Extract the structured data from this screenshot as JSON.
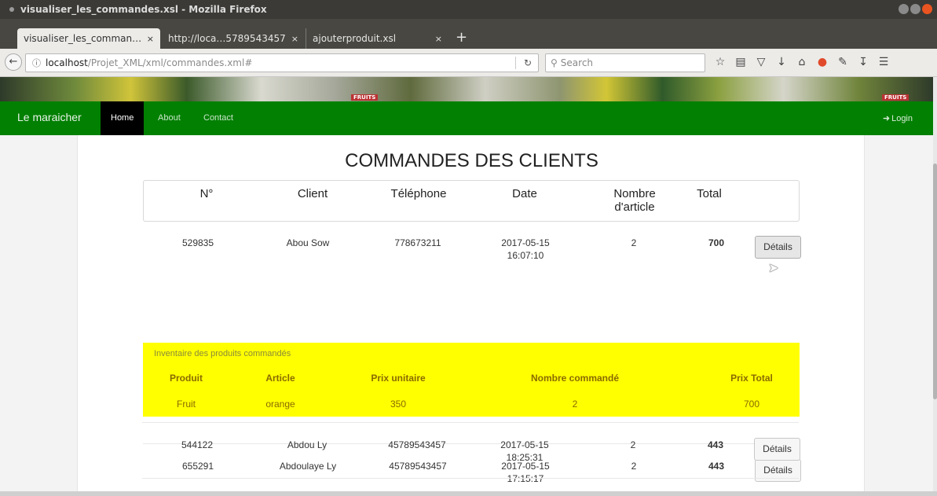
{
  "window": {
    "title": "visualiser_les_commandes.xsl - Mozilla Firefox"
  },
  "tabs": [
    {
      "label": "visualiser_les_comman…",
      "active": true
    },
    {
      "label": "http://loca…5789543457",
      "active": false
    },
    {
      "label": "ajouterproduit.xsl",
      "active": false
    }
  ],
  "tab_close_glyph": "×",
  "new_tab_glyph": "+",
  "url": {
    "host": "localhost",
    "path": "/Projet_XML/xml/commandes.xml#"
  },
  "search": {
    "placeholder": "Search"
  },
  "site": {
    "brand": "Le maraicher",
    "nav": {
      "home": "Home",
      "about": "About",
      "contact": "Contact"
    },
    "login": "Login",
    "banner_tag": "FRUITS"
  },
  "page": {
    "title": "COMMANDES DES CLIENTS",
    "columns": {
      "num": "N°",
      "client": "Client",
      "phone": "Téléphone",
      "date": "Date",
      "count_l1": "Nombre",
      "count_l2": "d'article",
      "total": "Total"
    },
    "details_label": "Détails",
    "orders": [
      {
        "num": "529835",
        "client": "Abou  Sow",
        "phone": "778673211",
        "date": "2017-05-15",
        "time": "16:07:10",
        "count": "2",
        "total": "700"
      },
      {
        "num": "655291",
        "client": "Abdoulaye  Ly",
        "phone": "45789543457",
        "date": "2017-05-15",
        "time": "17:15:17",
        "count": "2",
        "total": "443"
      },
      {
        "num": "544122",
        "client": "Abdou  Ly",
        "phone": "45789543457",
        "date": "2017-05-15",
        "time": "18:25:31",
        "count": "2",
        "total": "443"
      }
    ],
    "inventory": {
      "title": "Inventaire des produits commandés",
      "headers": {
        "product": "Produit",
        "article": "Article",
        "unit_price": "Prix unitaire",
        "ordered": "Nombre commandé",
        "total_price": "Prix Total"
      },
      "row": {
        "product": "Fruit",
        "article": "orange",
        "unit_price": "350",
        "ordered": "2",
        "total_price": "700"
      }
    }
  },
  "colors": {
    "nav_green": "#028002",
    "highlight_yellow": "#ffff00",
    "firefox_orange": "#e95420"
  }
}
